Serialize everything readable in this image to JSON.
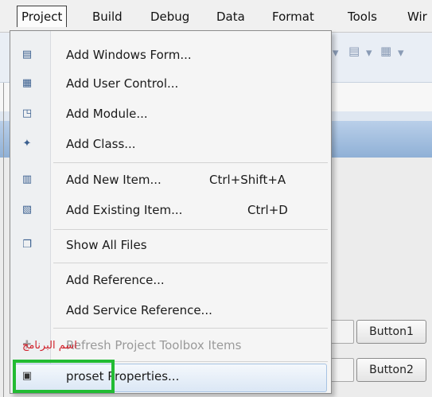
{
  "menubar": {
    "items": [
      {
        "label": "Project",
        "active": true
      },
      {
        "label": "Build"
      },
      {
        "label": "Debug"
      },
      {
        "label": "Data"
      },
      {
        "label": "Format"
      },
      {
        "label": "Tools"
      },
      {
        "label": "Wir"
      }
    ]
  },
  "dropdown": {
    "items": [
      {
        "label": "Add Windows Form...",
        "icon": "windows-form-icon"
      },
      {
        "label": "Add User Control...",
        "icon": "user-control-icon"
      },
      {
        "label": "Add Module...",
        "icon": "module-icon"
      },
      {
        "label": "Add Class...",
        "icon": "class-icon"
      },
      {
        "label": "Add New Item...",
        "shortcut": "Ctrl+Shift+A",
        "icon": "new-item-icon"
      },
      {
        "label": "Add Existing Item...",
        "shortcut": "Ctrl+D",
        "icon": "existing-item-icon"
      },
      {
        "label": "Show All Files",
        "icon": "show-all-files-icon"
      },
      {
        "label": "Add Reference..."
      },
      {
        "label": "Add Service Reference..."
      },
      {
        "label": "Refresh Project Toolbox Items",
        "disabled": true,
        "icon": "refresh-icon"
      },
      {
        "label": "proset Properties...",
        "hover": true,
        "icon": "properties-icon"
      }
    ]
  },
  "form": {
    "button1": "Button1",
    "button2": "Button2"
  },
  "annotation": {
    "arabic_text": "اسم البرنامج",
    "highlight_color": "#22bb33",
    "text_color": "#d0202a"
  }
}
